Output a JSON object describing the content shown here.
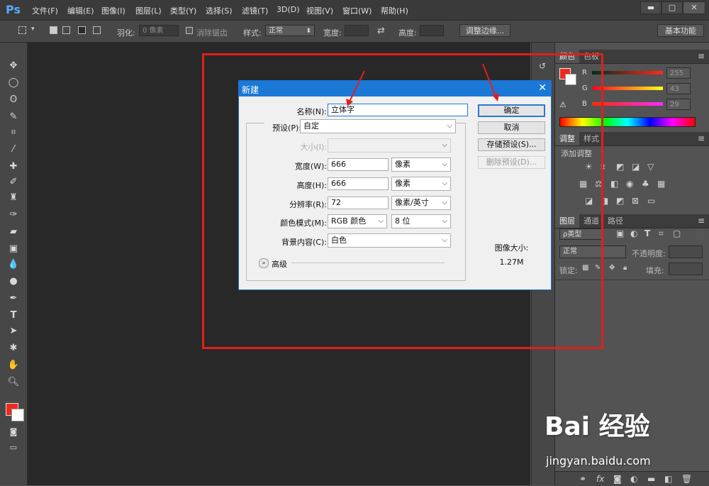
{
  "menubar": {
    "logo": "Ps",
    "items": [
      "文件(F)",
      "编辑(E)",
      "图像(I)",
      "图层(L)",
      "类型(Y)",
      "选择(S)",
      "滤镜(T)",
      "3D(D)",
      "视图(V)",
      "窗口(W)",
      "帮助(H)"
    ],
    "window_buttons": [
      "▬",
      "▢",
      "✕"
    ]
  },
  "options": {
    "feather_label": "羽化:",
    "feather_value": "0 像素",
    "antialias_label": "消除锯齿",
    "style_label": "样式:",
    "style_value": "正常",
    "width_label": "宽度:",
    "height_label": "高度:",
    "refine_button": "调整边缘...",
    "workspace_button": "基本功能"
  },
  "color_panel": {
    "tabs": [
      "颜色",
      "色板"
    ],
    "channels": [
      {
        "name": "R",
        "value": "255"
      },
      {
        "name": "G",
        "value": "43"
      },
      {
        "name": "B",
        "value": "29"
      }
    ],
    "foreground": "#ee2a1e"
  },
  "adjust_panel": {
    "tabs": [
      "调整",
      "样式"
    ],
    "add_label": "添加调整"
  },
  "layers_panel": {
    "tabs": [
      "图层",
      "通道",
      "路径"
    ],
    "kind": "ρ类型",
    "blend": "正常",
    "opacity_label": "不透明度:",
    "lock_label": "锁定:",
    "fill_label": "填充:"
  },
  "dialog": {
    "title": "新建",
    "name_label": "名称(N):",
    "name_value": "立体字",
    "preset_label": "预设(P):",
    "preset_value": "自定",
    "size_label": "大小(I):",
    "width_label": "宽度(W):",
    "width_value": "666",
    "width_unit": "像素",
    "height_label": "高度(H):",
    "height_value": "666",
    "height_unit": "像素",
    "resolution_label": "分辨率(R):",
    "resolution_value": "72",
    "resolution_unit": "像素/英寸",
    "colormode_label": "颜色模式(M):",
    "colormode_value": "RGB 颜色",
    "bitdepth_value": "8 位",
    "background_label": "背景内容(C):",
    "background_value": "白色",
    "advanced_label": "高级",
    "ok_button": "确定",
    "cancel_button": "取消",
    "save_preset_button": "存储预设(S)...",
    "delete_preset_button": "删除预设(D)...",
    "image_size_label": "图像大小:",
    "image_size_value": "1.27M"
  },
  "watermark": {
    "brand": "Bai 经验",
    "url": "jingyan.baidu.com"
  }
}
